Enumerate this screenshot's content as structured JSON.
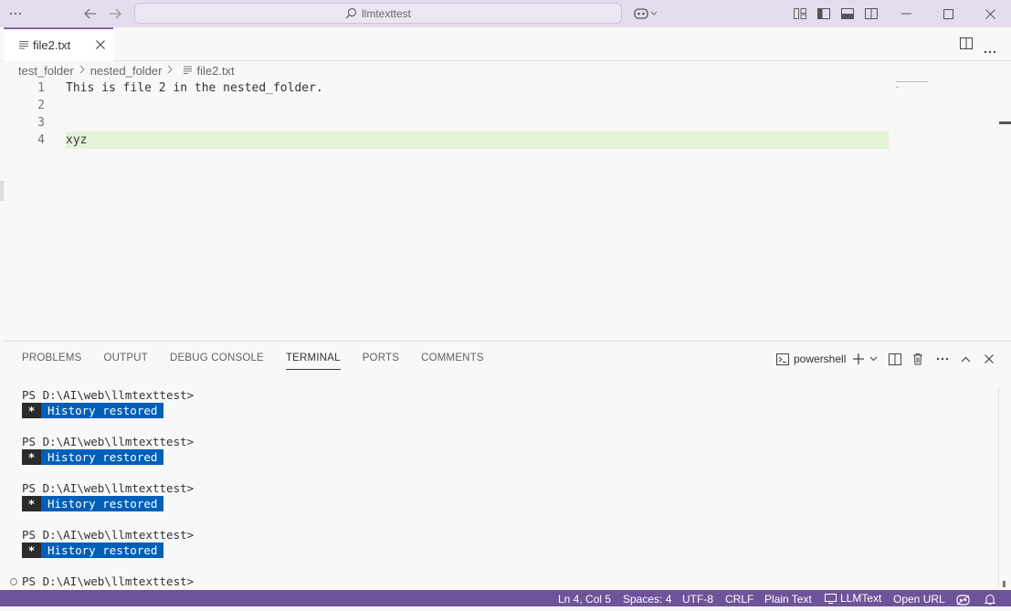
{
  "titlebar": {
    "search_text": "llmtexttest"
  },
  "tab": {
    "label": "file2.txt"
  },
  "breadcrumb": {
    "items": [
      "test_folder",
      "nested_folder",
      "file2.txt"
    ]
  },
  "editor": {
    "lines": [
      {
        "number": "1",
        "text": "This is file 2 in the nested_folder."
      },
      {
        "number": "2",
        "text": ""
      },
      {
        "number": "3",
        "text": ""
      },
      {
        "number": "4",
        "text": "xyz"
      }
    ]
  },
  "panel": {
    "tabs": [
      "PROBLEMS",
      "OUTPUT",
      "DEBUG CONSOLE",
      "TERMINAL",
      "PORTS",
      "COMMENTS"
    ],
    "active_tab": "TERMINAL",
    "terminal_name": "powershell"
  },
  "terminal": {
    "blocks": [
      {
        "prompt": "PS D:\\AI\\web\\llmtexttest>",
        "badge_star": "*",
        "badge_text": "History restored"
      },
      {
        "prompt": "PS D:\\AI\\web\\llmtexttest>",
        "badge_star": "*",
        "badge_text": "History restored"
      },
      {
        "prompt": "PS D:\\AI\\web\\llmtexttest>",
        "badge_star": "*",
        "badge_text": "History restored"
      },
      {
        "prompt": "PS D:\\AI\\web\\llmtexttest>",
        "badge_star": "*",
        "badge_text": "History restored"
      }
    ],
    "current_prompt": "PS D:\\AI\\web\\llmtexttest>"
  },
  "statusbar": {
    "position": "Ln 4, Col 5",
    "spaces": "Spaces: 4",
    "encoding": "UTF-8",
    "eol": "CRLF",
    "language": "Plain Text",
    "extension": "LLMText",
    "open_url": "Open URL"
  },
  "colors": {
    "titlebar_bg": "#e5dcee",
    "statusbar_bg": "#6f5399",
    "active_line_bg": "#e5f3d8",
    "badge_blue": "#005fb8"
  }
}
